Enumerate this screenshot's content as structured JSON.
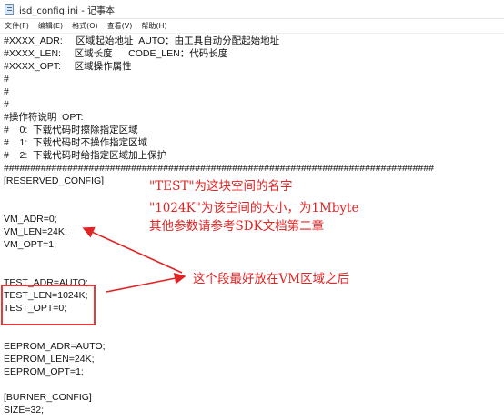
{
  "window": {
    "title": "isd_config.ini - 记事本"
  },
  "menu": [
    "文件(F)",
    "编辑(E)",
    "格式(O)",
    "查看(V)",
    "帮助(H)"
  ],
  "editor_lines": [
    "#XXXX_ADR:     区域起始地址  AUTO：由工具自动分配起始地址",
    "#XXXX_LEN:     区域长度      CODE_LEN：代码长度",
    "#XXXX_OPT:     区域操作属性",
    "#",
    "#",
    "#",
    "#操作符说明  OPT:",
    "#    0:  下载代码时擦除指定区域",
    "#    1:  下载代码时不操作指定区域",
    "#    2:  下载代码时给指定区域加上保护",
    "#################################################################################",
    "[RESERVED_CONFIG]",
    "",
    "",
    "VM_ADR=0;",
    "VM_LEN=24K;",
    "VM_OPT=1;",
    "",
    "",
    "TEST_ADR=AUTO;",
    "TEST_LEN=1024K;",
    "TEST_OPT=0;",
    "",
    "",
    "EEPROM_ADR=AUTO;",
    "EEPROM_LEN=24K;",
    "EEPROM_OPT=1;",
    "",
    "[BURNER_CONFIG]",
    "SIZE=32;"
  ],
  "annotations": {
    "line1": "\"TEST\"为这块空间的名字",
    "line2": "\"1024K\"为该空间的大小，为1Mbyte",
    "line3": "其他参数请参考SDK文档第二章",
    "line4": "这个段最好放在VM区域之后"
  },
  "colors": {
    "annotation": "#e02424",
    "text": "#111111"
  }
}
